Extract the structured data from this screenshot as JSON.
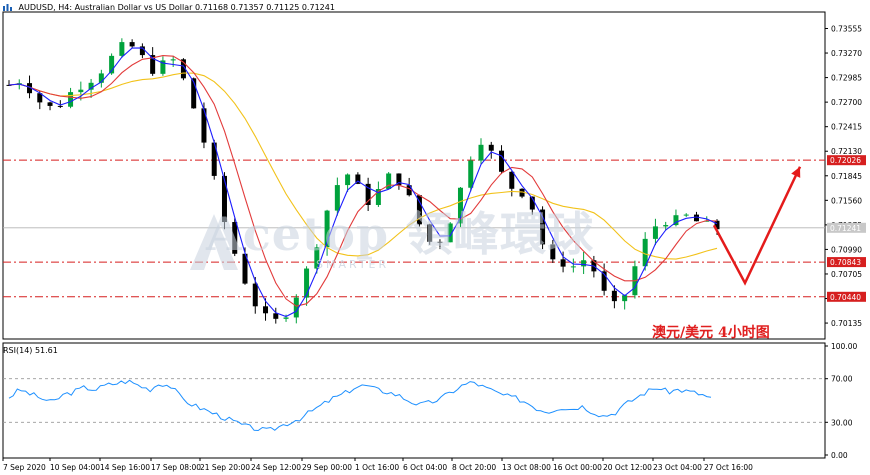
{
  "header": {
    "symbol": "AUDUSD, H4:",
    "description": "Australian Dollar vs US Dollar",
    "ohlc": "0.71168 0.71357 0.71125 0.71241"
  },
  "rsi_title": "RSI(14) 51.61",
  "annotation": "澳元/美元  4小时图",
  "watermark": {
    "brand": "Acetop",
    "brand_cn": "領峰環球",
    "tagline": "SMARTER"
  },
  "colors": {
    "bull": "#00a23c",
    "bear": "#000000",
    "ma_fast": "#1d1dff",
    "ma_mid": "#e23b3b",
    "ma_slow": "#f2c21a",
    "rsi": "#1e90ff",
    "level_line": "#d61f1f",
    "arrow": "#e41b1b",
    "price_tag_bg": "#d61f1f",
    "current_price_bg": "#c8c8c8"
  },
  "chart_data": [
    {
      "type": "candlestick",
      "symbol": "AUDUSD",
      "timeframe": "H4",
      "ylim": [
        0.6995,
        0.737
      ],
      "y_ticks": [
        "0.73555",
        "0.73270",
        "0.72985",
        "0.72700",
        "0.72415",
        "0.72130",
        "0.71845",
        "0.71560",
        "0.71275",
        "0.70990",
        "0.70705",
        "0.70420",
        "0.70135"
      ],
      "x_ticks": [
        "7 Sep 2020",
        "10 Sep 04:00",
        "14 Sep 16:00",
        "17 Sep 08:00",
        "21 Sep 20:00",
        "24 Sep 12:00",
        "29 Sep 00:00",
        "1 Oct 16:00",
        "6 Oct 04:00",
        "8 Oct 20:00",
        "13 Oct 08:00",
        "16 Oct 00:00",
        "20 Oct 12:00",
        "23 Oct 04:00",
        "27 Oct 16:00"
      ],
      "price_path": [
        0.729,
        0.7296,
        0.7285,
        0.7268,
        0.7262,
        0.7271,
        0.7286,
        0.7294,
        0.7301,
        0.7315,
        0.733,
        0.7338,
        0.7325,
        0.7308,
        0.7312,
        0.732,
        0.7296,
        0.7262,
        0.722,
        0.717,
        0.712,
        0.7085,
        0.7052,
        0.7026,
        0.7012,
        0.7018,
        0.7038,
        0.7062,
        0.7098,
        0.7138,
        0.7172,
        0.7188,
        0.717,
        0.7155,
        0.7168,
        0.7185,
        0.7178,
        0.715,
        0.7118,
        0.7102,
        0.7118,
        0.715,
        0.7192,
        0.7232,
        0.7218,
        0.719,
        0.7172,
        0.7168,
        0.715,
        0.7105,
        0.708,
        0.7085,
        0.7078,
        0.709,
        0.7068,
        0.7035,
        0.703,
        0.7062,
        0.7098,
        0.7122,
        0.7135,
        0.713,
        0.7138,
        0.7132,
        0.7126,
        0.7124
      ],
      "candle_count": 70,
      "moving_averages": [
        {
          "color": "ma_fast",
          "period": "fast"
        },
        {
          "color": "ma_mid",
          "period": "medium"
        },
        {
          "color": "ma_slow",
          "period": "slow"
        }
      ],
      "horizontal_levels": [
        "0.72026",
        "0.70843",
        "0.70440"
      ],
      "current_price": "0.71241",
      "forecast": {
        "direction": "down then up",
        "low": 0.706,
        "target": 0.7195
      }
    },
    {
      "type": "line",
      "name": "RSI(14)",
      "ylim": [
        0,
        100
      ],
      "y_ticks": [
        "100.00",
        "70.00",
        "30.00",
        "0.00"
      ],
      "levels": [
        70,
        30
      ],
      "last_value": 51.61,
      "values": [
        53,
        60,
        56,
        52,
        48,
        55,
        58,
        62,
        60,
        64,
        66,
        68,
        64,
        60,
        66,
        63,
        52,
        46,
        42,
        38,
        34,
        30,
        26,
        24,
        22,
        26,
        30,
        34,
        40,
        46,
        52,
        56,
        62,
        64,
        60,
        58,
        55,
        50,
        46,
        48,
        52,
        58,
        64,
        67,
        62,
        58,
        54,
        52,
        48,
        42,
        40,
        44,
        42,
        45,
        40,
        36,
        38,
        46,
        52,
        58,
        62,
        58,
        60,
        58,
        56,
        52
      ]
    }
  ]
}
